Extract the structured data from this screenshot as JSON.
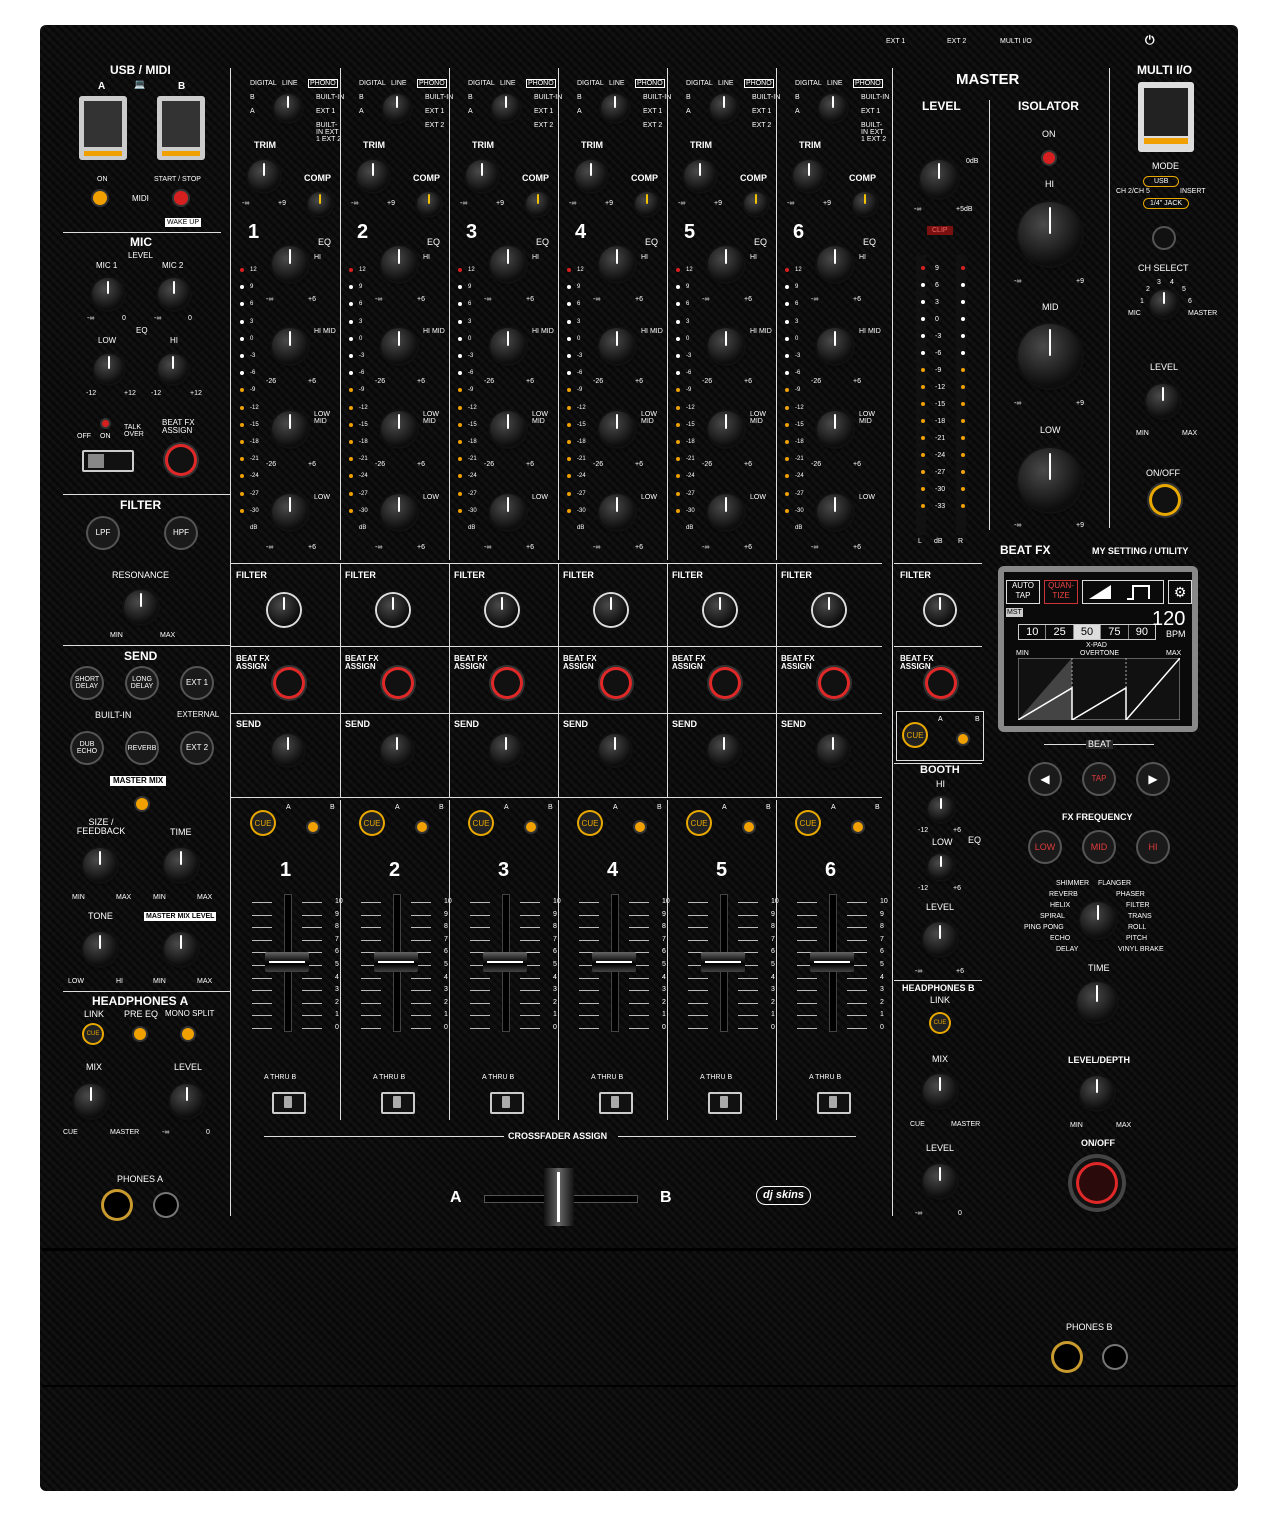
{
  "top_labels": {
    "ext1": "EXT 1",
    "ext2": "EXT 2",
    "multi_io": "MULTI I/O",
    "power": "⏻"
  },
  "usb_midi": {
    "title": "USB / MIDI",
    "a": "A",
    "b": "B",
    "laptop": "💻",
    "on": "ON",
    "start_stop": "START / STOP",
    "midi": "MIDI",
    "wake_up": "WAKE UP"
  },
  "mic": {
    "title": "MIC",
    "level": "LEVEL",
    "mic1": "MIC 1",
    "mic2": "MIC 2",
    "eq": "EQ",
    "low": "LOW",
    "hi": "HI",
    "minus_inf": "-∞",
    "zero": "0",
    "m12": "-12",
    "p12": "+12",
    "off": "OFF",
    "on": "ON",
    "talk_over": "TALK OVER",
    "beat_fx_assign": "BEAT FX ASSIGN"
  },
  "filter_left": {
    "title": "FILTER",
    "lpf": "LPF",
    "hpf": "HPF",
    "resonance": "RESONANCE",
    "min": "MIN",
    "max": "MAX"
  },
  "send": {
    "title": "SEND",
    "short_delay": "SHORT DELAY",
    "long_delay": "LONG DELAY",
    "ext1": "EXT 1",
    "built_in": "BUILT-IN",
    "external": "EXTERNAL",
    "dub_echo": "DUB ECHO",
    "reverb": "REVERB",
    "ext2": "EXT 2",
    "master_mix": "MASTER MIX",
    "size_feedback": "SIZE / FEEDBACK",
    "time": "TIME",
    "tone": "TONE",
    "master_mix_level": "MASTER MIX LEVEL",
    "min": "MIN",
    "max": "MAX",
    "low": "LOW",
    "hi": "HI"
  },
  "headphones_a": {
    "title": "HEADPHONES A",
    "link": "LINK",
    "pre_eq": "PRE EQ",
    "mono_split": "MONO SPLIT",
    "cue": "CUE",
    "mix": "MIX",
    "level": "LEVEL",
    "cue_lbl": "CUE",
    "master": "MASTER",
    "minus_inf": "-∞",
    "zero": "0",
    "phones": "PHONES A"
  },
  "channel": {
    "numbers": [
      "1",
      "2",
      "3",
      "4",
      "5",
      "6"
    ],
    "input_labels": {
      "digital": "DIGITAL",
      "line": "LINE",
      "phono": "PHONO",
      "b": "B",
      "a": "A",
      "built_in": "BUILT-IN",
      "ext1": "EXT 1",
      "ext2": "EXT 2",
      "stack": "BUILT-IN EXT 1 EXT 2"
    },
    "trim": "TRIM",
    "comp": "COMP",
    "eq": "EQ",
    "hi": "HI",
    "hi_mid": "HI MID",
    "low_mid": "LOW MID",
    "low": "LOW",
    "minus_inf": "-∞",
    "p9": "+9",
    "m26": "-26",
    "p6": "+6",
    "meter": [
      "12",
      "9",
      "6",
      "3",
      "0",
      "-3",
      "-6",
      "-9",
      "-12",
      "-15",
      "-18",
      "-21",
      "-24",
      "-27",
      "-30",
      "dB"
    ],
    "filter": "FILTER",
    "beat_fx_assign": "BEAT FX ASSIGN",
    "send": "SEND",
    "cue": "CUE",
    "a": "A",
    "b": "B",
    "fader_scale": [
      "10",
      "9",
      "8",
      "7",
      "6",
      "5",
      "4",
      "3",
      "2",
      "1",
      "0"
    ],
    "thru": "A   THRU   B"
  },
  "crossfader": {
    "assign": "CROSSFADER ASSIGN",
    "a": "A",
    "b": "B"
  },
  "master": {
    "title": "MASTER",
    "level": "LEVEL",
    "zero_db": "0dB",
    "minus_inf": "-∞",
    "p5db": "+5dB",
    "clip": "CLIP",
    "meter": [
      "9",
      "6",
      "3",
      "0",
      "-3",
      "-6",
      "-9",
      "-12",
      "-15",
      "-18",
      "-21",
      "-24",
      "-27",
      "-30",
      "-33"
    ],
    "l": "L",
    "db": "dB",
    "r": "R",
    "filter": "FILTER",
    "beat_fx_assign": "BEAT FX ASSIGN",
    "cue": "CUE",
    "a": "A",
    "b": "B"
  },
  "isolator": {
    "title": "ISOLATOR",
    "on": "ON",
    "hi": "HI",
    "mid": "MID",
    "low": "LOW",
    "minus_inf": "-∞",
    "p9": "+9"
  },
  "booth": {
    "title": "BOOTH",
    "hi": "HI",
    "low": "LOW",
    "eq": "EQ",
    "m12": "-12",
    "p6": "+6",
    "level": "LEVEL",
    "minus_inf": "-∞"
  },
  "headphones_b": {
    "title": "HEADPHONES B",
    "link": "LINK",
    "cue": "CUE",
    "mix": "MIX",
    "cue_lbl": "CUE",
    "master": "MASTER",
    "level": "LEVEL",
    "minus_inf": "-∞",
    "zero": "0",
    "phones": "PHONES B"
  },
  "multi_io": {
    "title": "MULTI I/O",
    "mode": "MODE",
    "usb": "USB",
    "ch25": "CH 2/CH 5",
    "insert": "INSERT",
    "jack": "1/4\" JACK",
    "ch_select": "CH SELECT",
    "mic": "MIC",
    "master": "MASTER",
    "nums": [
      "1",
      "2",
      "3",
      "4",
      "5",
      "6"
    ],
    "level": "LEVEL",
    "min": "MIN",
    "max": "MAX",
    "on_off": "ON/OFF"
  },
  "beat_fx": {
    "title": "BEAT FX",
    "my_setting": "MY SETTING / UTILITY",
    "auto_tap": "AUTO TAP",
    "quantize": "QUAN-TIZE",
    "mst": "MST",
    "beats": [
      "10",
      "25",
      "50",
      "75",
      "90"
    ],
    "bpm": "120",
    "bpm_unit": "BPM",
    "xpad": "X-PAD",
    "overtone": "OVERTONE",
    "min": "MIN",
    "max": "MAX",
    "beat": "BEAT",
    "tap": "TAP",
    "prev": "◀",
    "next": "▶",
    "fx_frequency": "FX FREQUENCY",
    "low": "LOW",
    "mid": "MID",
    "hi": "HI",
    "fx_left": [
      "SHIMMER",
      "REVERB",
      "HELIX",
      "SPIRAL",
      "PING PONG",
      "ECHO",
      "DELAY"
    ],
    "fx_right": [
      "FLANGER",
      "PHASER",
      "FILTER",
      "TRANS",
      "ROLL",
      "PITCH",
      "VINYL BRAKE"
    ],
    "time": "TIME",
    "level_depth": "LEVEL/DEPTH",
    "min2": "MIN",
    "max2": "MAX",
    "on_off": "ON/OFF"
  },
  "brand": "dj skins"
}
